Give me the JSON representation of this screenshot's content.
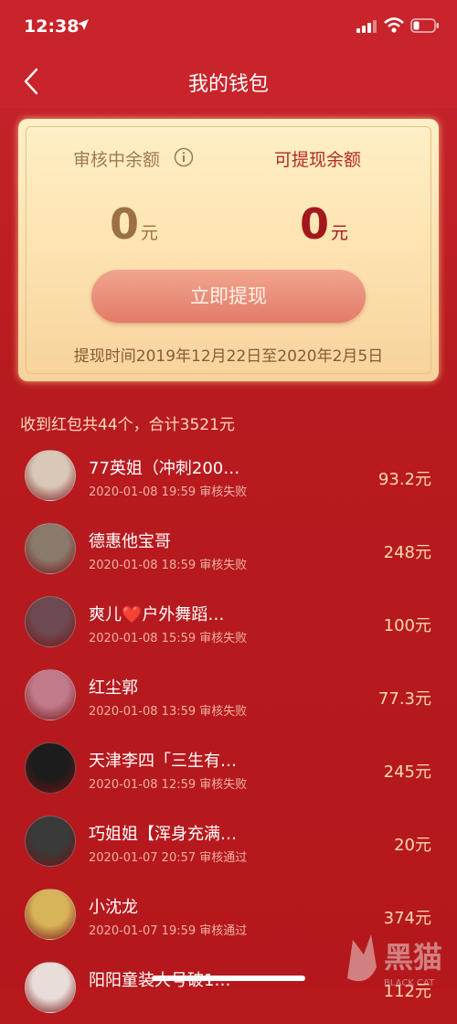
{
  "status_bar": {
    "time": "12:38"
  },
  "header": {
    "title": "我的钱包"
  },
  "wallet": {
    "review_label": "审核中余额",
    "withdrawable_label": "可提现余额",
    "review_amount": "0",
    "withdrawable_amount": "0",
    "unit": "元",
    "withdraw_button": "立即提现",
    "withdraw_period": "提现时间2019年12月22日至2020年2月5日"
  },
  "summary": "收到红包共44个，合计3521元",
  "records": [
    {
      "name": "77英姐（冲刺200…",
      "time": "2020-01-08 19:59",
      "status": "审核失败",
      "amount": "93.2元",
      "avatar_color": "#d9c7b8"
    },
    {
      "name": "德惠他宝哥",
      "time": "2020-01-08 18:59",
      "status": "审核失败",
      "amount": "248元",
      "avatar_color": "#8a7a6c"
    },
    {
      "name": "爽儿❤️户外舞蹈…",
      "time": "2020-01-08 15:59",
      "status": "审核失败",
      "amount": "100元",
      "avatar_color": "#6d4a52"
    },
    {
      "name": "红尘郭",
      "time": "2020-01-08 13:59",
      "status": "审核失败",
      "amount": "77.3元",
      "avatar_color": "#c07a8a"
    },
    {
      "name": "天津李四「三生有…",
      "time": "2020-01-08 12:59",
      "status": "审核失败",
      "amount": "245元",
      "avatar_color": "#1c1c1c"
    },
    {
      "name": "巧姐姐【浑身充满…",
      "time": "2020-01-07 20:57",
      "status": "审核通过",
      "amount": "20元",
      "avatar_color": "#3a3a3a"
    },
    {
      "name": "小沈龙",
      "time": "2020-01-07 19:59",
      "status": "审核通过",
      "amount": "374元",
      "avatar_color": "#d7b35a"
    },
    {
      "name": "阳阳童装大号破1…",
      "time": "",
      "status": "",
      "amount": "112元",
      "avatar_color": "#e8ddd8"
    }
  ],
  "watermark": {
    "text": "黑猫",
    "subtext": "BLACK CAT"
  },
  "colors": {
    "primary_red": "#c9242b",
    "card_gold": "#fde3b0",
    "button_salmon": "#e88a75"
  }
}
